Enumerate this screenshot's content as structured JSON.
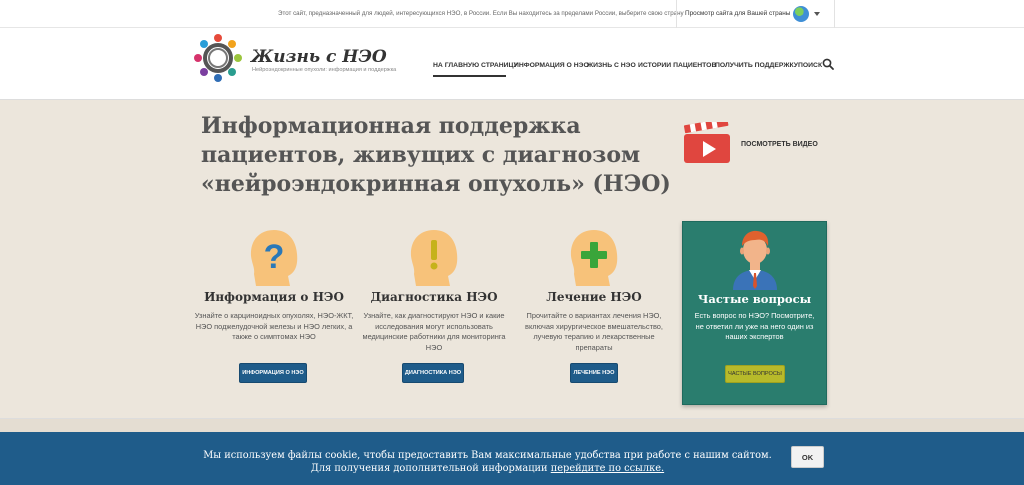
{
  "topbar": {
    "notice": "Этот сайт, предназначенный для людей, интересующихся НЭО, в России. Если Вы находитесь за пределами России, выберите свою страну",
    "country_label": "Просмотр сайта для Вашей страны"
  },
  "brand": {
    "title": "Жизнь с НЭО",
    "subtitle": "Нейроэндокринные опухоли: информация и поддержка"
  },
  "nav": {
    "items": [
      {
        "label": "НА ГЛАВНУЮ СТРАНИЦУ"
      },
      {
        "label": "ИНФОРМАЦИЯ О НЭО"
      },
      {
        "label": "ЖИЗНЬ С НЭО"
      },
      {
        "label": "ИСТОРИИ ПАЦИЕНТОВ"
      },
      {
        "label": "ПОЛУЧИТЬ ПОДДЕРЖКУ"
      },
      {
        "label": "ПОИСК"
      }
    ],
    "active_index": 0
  },
  "hero": {
    "title": "Информационная поддержка пациентов, живущих с диагнозом «нейроэндокринная опухоль» (НЭО)",
    "video_label": "ПОСМОТРЕТЬ ВИДЕО"
  },
  "features": [
    {
      "icon": "question-head-icon",
      "title": "Информация о НЭО",
      "desc": "Узнайте о карциноидных опухолях, НЭО-ЖКТ, НЭО поджелудочной железы и НЭО легких, а также о симптомах НЭО",
      "button": "ИНФОРМАЦИЯ О НЭО"
    },
    {
      "icon": "exclamation-head-icon",
      "title": "Диагностика НЭО",
      "desc": "Узнайте, как диагностируют НЭО и какие исследования могут использовать медицинские работники для мониторинга НЭО",
      "button": "ДИАГНОСТИКА НЭО"
    },
    {
      "icon": "plus-head-icon",
      "title": "Лечение НЭО",
      "desc": "Прочитайте о вариантах лечения НЭО, включая хирургическое вмешательство, лучевую терапию и лекарственные препараты",
      "button": "ЛЕЧЕНИЕ НЭО"
    }
  ],
  "faq": {
    "title": "Частые вопросы",
    "desc": "Есть вопрос по НЭО? Посмотрите, не ответил ли уже на него один из наших экспертов",
    "button": "ЧАСТЫЕ ВОПРОСЫ"
  },
  "cookie": {
    "line1": "Мы используем файлы cookie, чтобы предоставить Вам максимальные удобства при работе с нашим сайтом.",
    "line2_prefix": "Для получения дополнительной информации ",
    "link": "перейдите по ссылке.",
    "ok": "OK"
  },
  "colors": {
    "primary_blue": "#1f5c8a",
    "faq_green": "#2a7d6e",
    "faq_button": "#b7ba2a",
    "icon_head": "#f7c27a",
    "icon_question": "#2a78b8",
    "icon_exclamation": "#c6b21b",
    "icon_plus": "#3aa53a",
    "video_red": "#e0463f"
  }
}
